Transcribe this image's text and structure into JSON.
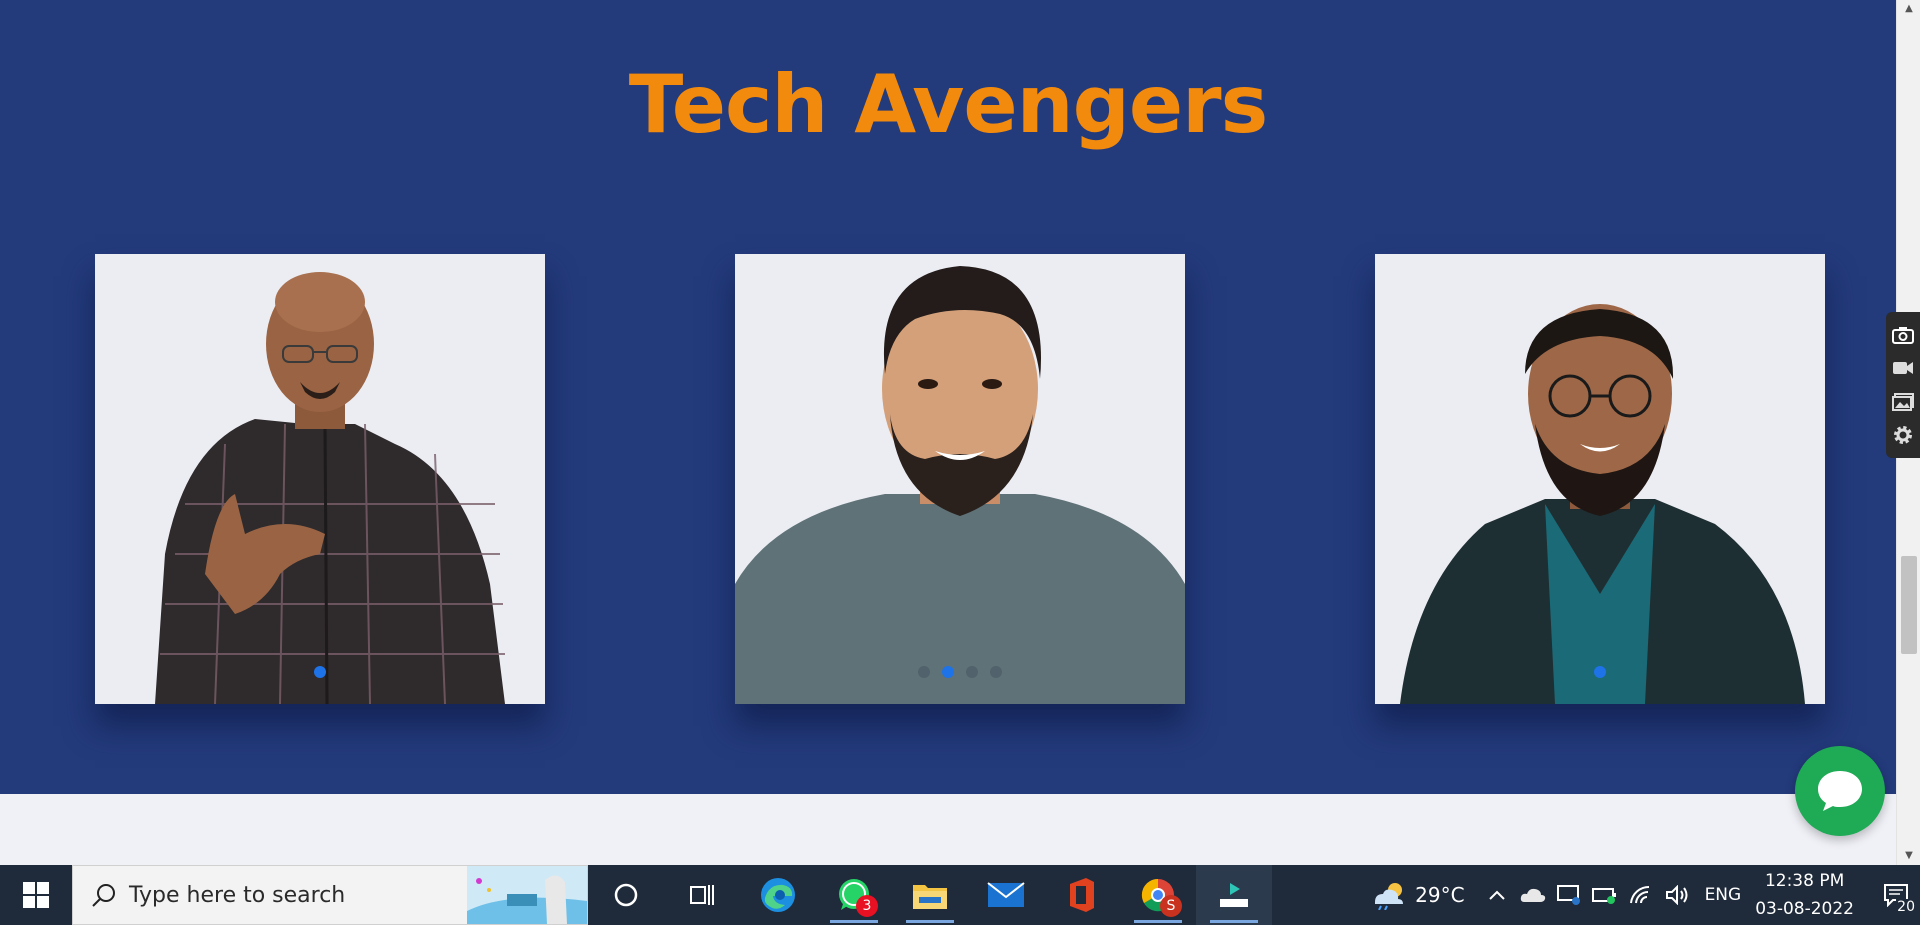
{
  "page": {
    "title": "Tech Avengers",
    "cards": [
      {
        "name": "avenger-card-1",
        "dots": [
          true
        ]
      },
      {
        "name": "avenger-card-2",
        "dots": [
          false,
          true,
          false,
          false
        ]
      },
      {
        "name": "avenger-card-3",
        "dots": [
          true
        ]
      }
    ]
  },
  "colors": {
    "hero_bg": "#233a7b",
    "title": "#f28a0d",
    "chat": "#1faa55",
    "dot_active": "#1e73e8"
  },
  "taskbar": {
    "search_placeholder": "Type here to search",
    "whatsapp_badge": "3",
    "chrome_badge": "S",
    "weather_temp": "29°C",
    "language": "ENG",
    "time": "12:38 PM",
    "date": "03-08-2022",
    "notifications_count": "20"
  }
}
